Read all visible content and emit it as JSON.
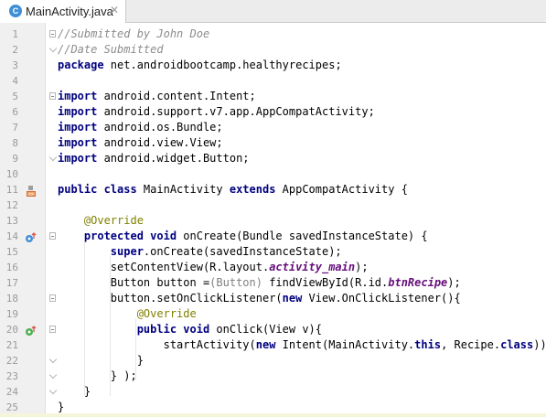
{
  "tab": {
    "icon_letter": "C",
    "title": "MainActivity.java",
    "close_glyph": "✕"
  },
  "editor": {
    "lines": [
      {
        "num": "1",
        "tokens": [
          {
            "t": "//Submitted by John Doe",
            "c": "cm"
          }
        ]
      },
      {
        "num": "2",
        "tokens": [
          {
            "t": "//Date Submitted",
            "c": "cm"
          }
        ]
      },
      {
        "num": "3",
        "tokens": [
          {
            "t": "package",
            "c": "kw"
          },
          {
            "t": " net.androidbootcamp.healthyrecipes;",
            "c": ""
          }
        ]
      },
      {
        "num": "4",
        "tokens": []
      },
      {
        "num": "5",
        "tokens": [
          {
            "t": "import",
            "c": "kw"
          },
          {
            "t": " android.content.Intent;",
            "c": ""
          }
        ]
      },
      {
        "num": "6",
        "tokens": [
          {
            "t": "import",
            "c": "kw"
          },
          {
            "t": " android.support.v7.app.AppCompatActivity;",
            "c": ""
          }
        ]
      },
      {
        "num": "7",
        "tokens": [
          {
            "t": "import",
            "c": "kw"
          },
          {
            "t": " android.os.Bundle;",
            "c": ""
          }
        ]
      },
      {
        "num": "8",
        "tokens": [
          {
            "t": "import",
            "c": "kw"
          },
          {
            "t": " android.view.View;",
            "c": ""
          }
        ]
      },
      {
        "num": "9",
        "tokens": [
          {
            "t": "import",
            "c": "kw"
          },
          {
            "t": " android.widget.Button;",
            "c": ""
          }
        ]
      },
      {
        "num": "10",
        "tokens": []
      },
      {
        "num": "11",
        "tokens": [
          {
            "t": "public class",
            "c": "kw"
          },
          {
            "t": " MainActivity ",
            "c": ""
          },
          {
            "t": "extends",
            "c": "kw"
          },
          {
            "t": " AppCompatActivity {",
            "c": ""
          }
        ]
      },
      {
        "num": "12",
        "tokens": []
      },
      {
        "num": "13",
        "tokens": [
          {
            "t": "    ",
            "c": ""
          },
          {
            "t": "@Override",
            "c": "an"
          }
        ]
      },
      {
        "num": "14",
        "tokens": [
          {
            "t": "    ",
            "c": ""
          },
          {
            "t": "protected void",
            "c": "kw"
          },
          {
            "t": " onCreate(Bundle savedInstanceState) {",
            "c": ""
          }
        ]
      },
      {
        "num": "15",
        "tokens": [
          {
            "t": "        ",
            "c": ""
          },
          {
            "t": "super",
            "c": "kw"
          },
          {
            "t": ".onCreate(savedInstanceState);",
            "c": ""
          }
        ]
      },
      {
        "num": "16",
        "tokens": [
          {
            "t": "        setContentView(R.layout.",
            "c": ""
          },
          {
            "t": "activity_main",
            "c": "fd"
          },
          {
            "t": ");",
            "c": ""
          }
        ]
      },
      {
        "num": "17",
        "tokens": [
          {
            "t": "        Button button =",
            "c": ""
          },
          {
            "t": "(Button)",
            "c": "ct"
          },
          {
            "t": " findViewById(R.id.",
            "c": ""
          },
          {
            "t": "btnRecipe",
            "c": "fd"
          },
          {
            "t": ");",
            "c": ""
          }
        ]
      },
      {
        "num": "18",
        "tokens": [
          {
            "t": "        button.setOnClickListener(",
            "c": ""
          },
          {
            "t": "new",
            "c": "kw"
          },
          {
            "t": " View.OnClickListener(){",
            "c": ""
          }
        ]
      },
      {
        "num": "19",
        "tokens": [
          {
            "t": "            ",
            "c": ""
          },
          {
            "t": "@Override",
            "c": "an"
          }
        ]
      },
      {
        "num": "20",
        "tokens": [
          {
            "t": "            ",
            "c": ""
          },
          {
            "t": "public void",
            "c": "kw"
          },
          {
            "t": " onClick(View v){",
            "c": ""
          }
        ]
      },
      {
        "num": "21",
        "tokens": [
          {
            "t": "                startActivity(",
            "c": ""
          },
          {
            "t": "new",
            "c": "kw"
          },
          {
            "t": " Intent(MainActivity.",
            "c": ""
          },
          {
            "t": "this",
            "c": "kw"
          },
          {
            "t": ", Recipe.",
            "c": ""
          },
          {
            "t": "class",
            "c": "kw"
          },
          {
            "t": "));",
            "c": ""
          }
        ]
      },
      {
        "num": "22",
        "tokens": [
          {
            "t": "            }",
            "c": ""
          }
        ]
      },
      {
        "num": "23",
        "tokens": [
          {
            "t": "        } );",
            "c": ""
          }
        ]
      },
      {
        "num": "24",
        "tokens": [
          {
            "t": "    }",
            "c": ""
          }
        ]
      },
      {
        "num": "25",
        "tokens": [
          {
            "t": "}",
            "c": ""
          }
        ]
      }
    ],
    "fold_markers": {
      "1": "start",
      "2": "end",
      "5": "start",
      "9": "end",
      "14": "start",
      "18": "start",
      "20": "start",
      "22": "end",
      "23": "end",
      "24": "end"
    },
    "gutter_icons": {
      "11": "android-activity-icon",
      "14": "override-method-icon",
      "20": "implement-method-icon"
    }
  },
  "colors": {
    "keyword": "#000080",
    "comment": "#8c8c8c",
    "annotation": "#808000",
    "field": "#660e7a",
    "gutter_bg": "#f0f0f0",
    "tab_icon": "#3f8fd6"
  }
}
